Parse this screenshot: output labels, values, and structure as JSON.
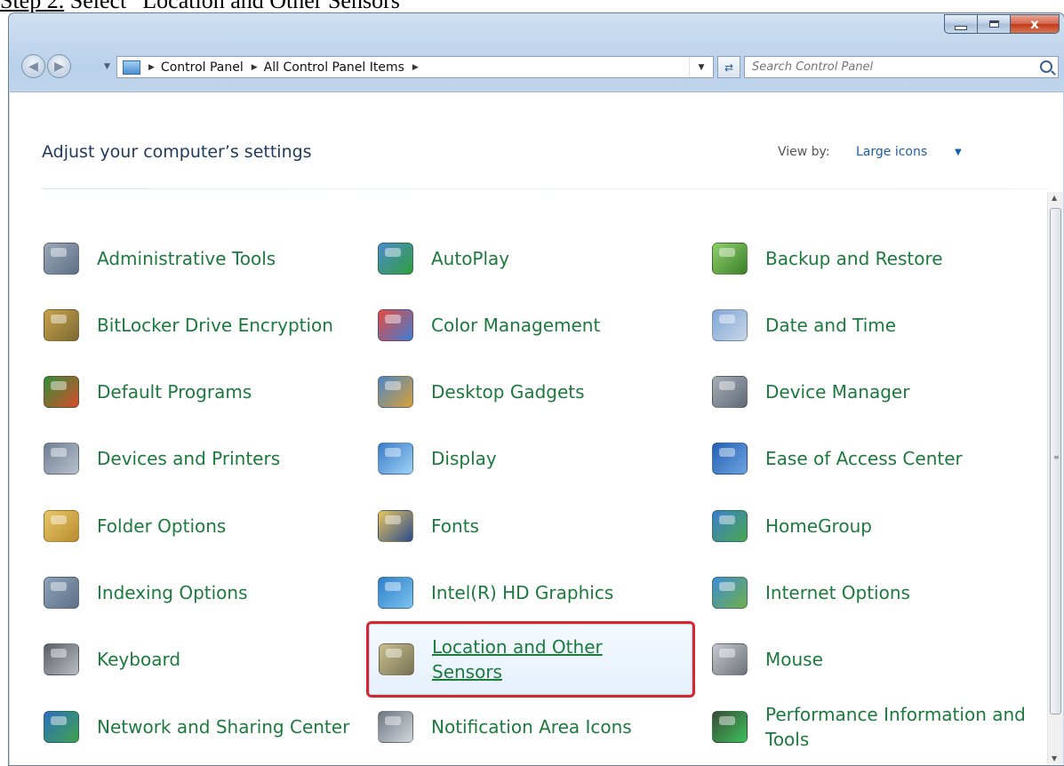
{
  "caption": {
    "step": "Step 2.",
    "text": " Select “Location and Other Sensors”"
  },
  "window": {
    "controls": {
      "minimize": "minimize",
      "maximize": "maximize",
      "close": "x"
    }
  },
  "address": {
    "crumbs": [
      "Control Panel",
      "All Control Panel Items"
    ]
  },
  "search": {
    "placeholder": "Search Control Panel"
  },
  "header": {
    "title": "Adjust your computer’s settings",
    "view_by_label": "View by:",
    "view_by_value": "Large icons"
  },
  "items": [
    {
      "label": "Administrative Tools",
      "icon": "admin-tools-icon"
    },
    {
      "label": "AutoPlay",
      "icon": "autoplay-icon"
    },
    {
      "label": "Backup and Restore",
      "icon": "backup-icon"
    },
    {
      "label": "BitLocker Drive Encryption",
      "icon": "bitlocker-icon"
    },
    {
      "label": "Color Management",
      "icon": "color-management-icon"
    },
    {
      "label": "Date and Time",
      "icon": "date-time-icon"
    },
    {
      "label": "Default Programs",
      "icon": "default-programs-icon"
    },
    {
      "label": "Desktop Gadgets",
      "icon": "desktop-gadgets-icon"
    },
    {
      "label": "Device Manager",
      "icon": "device-manager-icon"
    },
    {
      "label": "Devices and Printers",
      "icon": "devices-printers-icon"
    },
    {
      "label": "Display",
      "icon": "display-icon"
    },
    {
      "label": "Ease of Access Center",
      "icon": "ease-of-access-icon"
    },
    {
      "label": "Folder Options",
      "icon": "folder-options-icon"
    },
    {
      "label": "Fonts",
      "icon": "fonts-icon"
    },
    {
      "label": "HomeGroup",
      "icon": "homegroup-icon"
    },
    {
      "label": "Indexing Options",
      "icon": "indexing-icon"
    },
    {
      "label": "Intel(R) HD Graphics",
      "icon": "intel-graphics-icon"
    },
    {
      "label": "Internet Options",
      "icon": "internet-options-icon"
    },
    {
      "label": "Keyboard",
      "icon": "keyboard-icon"
    },
    {
      "label": "Location and Other Sensors",
      "icon": "location-sensors-icon",
      "selected": true
    },
    {
      "label": "Mouse",
      "icon": "mouse-icon"
    },
    {
      "label": "Network and Sharing Center",
      "icon": "network-sharing-icon"
    },
    {
      "label": "Notification Area Icons",
      "icon": "notification-area-icon"
    },
    {
      "label": "Performance Information and Tools",
      "icon": "performance-icon"
    }
  ]
}
